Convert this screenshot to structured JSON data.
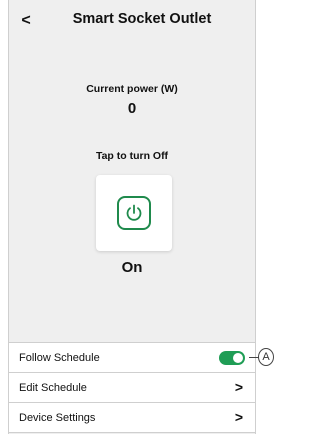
{
  "header": {
    "title": "Smart Socket Outlet",
    "back_icon": "chevron-left-icon"
  },
  "power": {
    "label": "Current power (W)",
    "value": "0"
  },
  "control": {
    "tap_label": "Tap to turn Off",
    "icon": "power-icon",
    "state": "On",
    "accent": "#1f8a4c"
  },
  "menu": {
    "items": [
      {
        "label": "Follow Schedule",
        "control": "toggle",
        "enabled": true
      },
      {
        "label": "Edit Schedule",
        "control": "chevron-right-icon"
      },
      {
        "label": "Device Settings",
        "control": "chevron-right-icon"
      }
    ]
  },
  "annotation": {
    "callout": "A"
  }
}
